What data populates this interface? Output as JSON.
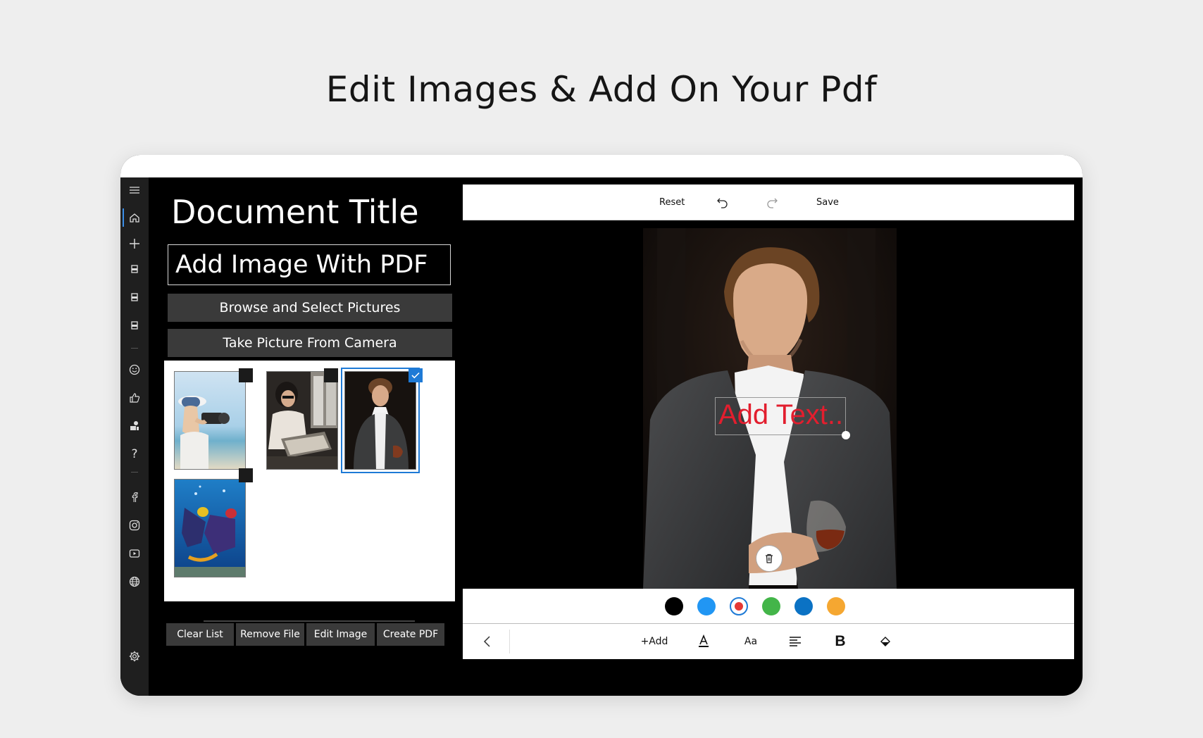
{
  "headline": "Edit Images & Add On Your Pdf",
  "left_panel": {
    "title": "Document Title",
    "name_value": "Add Image With PDF",
    "browse_label": "Browse and Select Pictures",
    "camera_label": "Take Picture From Camera",
    "actions": {
      "clear": "Clear List",
      "remove": "Remove File",
      "edit": "Edit Image",
      "create": "Create PDF"
    }
  },
  "sidebar": {
    "icons": [
      "menu-icon",
      "home-icon",
      "plus-icon",
      "pdf-file-icon",
      "pdf-file-icon",
      "pdf-file-icon",
      "smiley-icon",
      "thumbs-up-icon",
      "share-apps-icon",
      "help-icon",
      "facebook-icon",
      "instagram-icon",
      "youtube-icon",
      "globe-icon",
      "settings-icon"
    ],
    "active": "home-icon",
    "help_glyph": "?"
  },
  "gallery": [
    {
      "name": "photo-woman-camera-beach",
      "selected": false
    },
    {
      "name": "photo-woman-reading-book",
      "selected": false
    },
    {
      "name": "photo-man-jacket-glass",
      "selected": true
    },
    {
      "name": "photo-scuba-divers",
      "selected": false
    }
  ],
  "editor": {
    "reset_label": "Reset",
    "save_label": "Save",
    "overlay_text": "Add Text..",
    "overlay_color": "#e21e2e",
    "palette": [
      "#000000",
      "#2196f3",
      "#e53935",
      "#43b549",
      "#0b72c4",
      "#f5a731"
    ],
    "selected_color": "#e53935",
    "add_label": "+Add",
    "font_size_label": "Aa",
    "bold_label": "B"
  }
}
